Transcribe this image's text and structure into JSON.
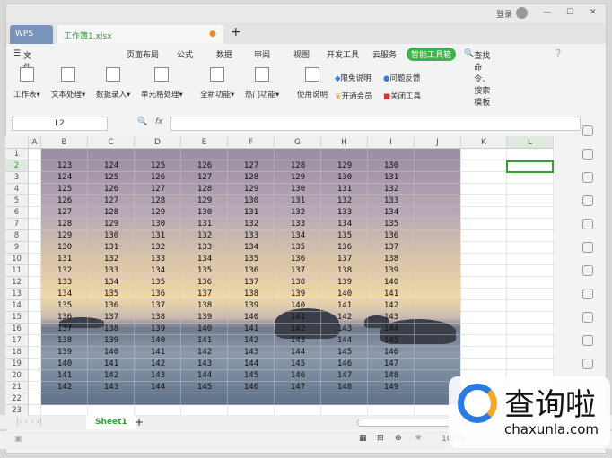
{
  "titlebar": {
    "login": "登录"
  },
  "tabs": {
    "wps": "WPS",
    "document": "工作簿1.xlsx",
    "new_tab": "+"
  },
  "menu": {
    "file": "文件",
    "items": [
      "页面布局",
      "公式",
      "数据",
      "审阅",
      "视图",
      "开发工具",
      "云服务"
    ],
    "smart": "智能工具箱",
    "search": "查找命令、搜索模板",
    "help": "?"
  },
  "toolbar": {
    "groups": [
      "工作表",
      "文本处理",
      "数据录入",
      "单元格处理",
      "全新功能",
      "热门功能",
      "使用说明"
    ],
    "small": [
      "限免说明",
      "问题反馈",
      "开通会员",
      "关闭工具"
    ]
  },
  "formula": {
    "namebox": "L2",
    "fx": "fx"
  },
  "columns": [
    "A",
    "B",
    "C",
    "D",
    "E",
    "F",
    "G",
    "H",
    "I",
    "J",
    "K",
    "L"
  ],
  "rows": [
    1,
    2,
    3,
    4,
    5,
    6,
    7,
    8,
    9,
    10,
    11,
    12,
    13,
    14,
    15,
    16,
    17,
    18,
    19,
    20,
    21,
    22,
    23
  ],
  "cells": [
    [
      123,
      124,
      125,
      126,
      127,
      128,
      129,
      130
    ],
    [
      124,
      125,
      126,
      127,
      128,
      129,
      130,
      131
    ],
    [
      125,
      126,
      127,
      128,
      129,
      130,
      131,
      132
    ],
    [
      126,
      127,
      128,
      129,
      130,
      131,
      132,
      133
    ],
    [
      127,
      128,
      129,
      130,
      131,
      132,
      133,
      134
    ],
    [
      128,
      129,
      130,
      131,
      132,
      133,
      134,
      135
    ],
    [
      129,
      130,
      131,
      132,
      133,
      134,
      135,
      136
    ],
    [
      130,
      131,
      132,
      133,
      134,
      135,
      136,
      137
    ],
    [
      131,
      132,
      133,
      134,
      135,
      136,
      137,
      138
    ],
    [
      132,
      133,
      134,
      135,
      136,
      137,
      138,
      139
    ],
    [
      133,
      134,
      135,
      136,
      137,
      138,
      139,
      140
    ],
    [
      134,
      135,
      136,
      137,
      138,
      139,
      140,
      141
    ],
    [
      135,
      136,
      137,
      138,
      139,
      140,
      141,
      142
    ],
    [
      136,
      137,
      138,
      139,
      140,
      141,
      142,
      143
    ],
    [
      137,
      138,
      139,
      140,
      141,
      142,
      143,
      144
    ],
    [
      138,
      139,
      140,
      141,
      142,
      143,
      144,
      145
    ],
    [
      139,
      140,
      141,
      142,
      143,
      144,
      145,
      146
    ],
    [
      140,
      141,
      142,
      143,
      144,
      145,
      146,
      147
    ],
    [
      141,
      142,
      143,
      144,
      145,
      146,
      147,
      148
    ],
    [
      142,
      143,
      144,
      145,
      146,
      147,
      148,
      149
    ]
  ],
  "sheets": {
    "active": "Sheet1",
    "add": "+"
  },
  "status": {
    "zoom": "100%"
  },
  "watermark": {
    "name": "查询啦",
    "url": "chaxunla.com"
  }
}
